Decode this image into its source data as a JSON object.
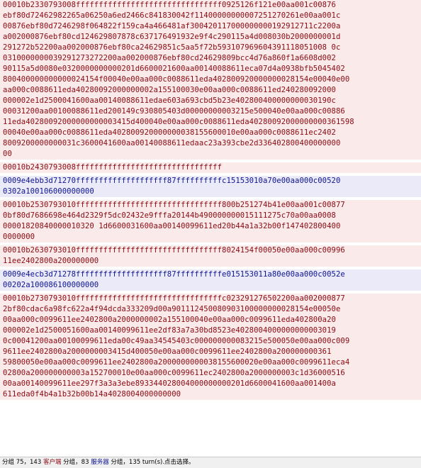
{
  "colors": {
    "client_bg": "#faeaea",
    "client_text": "#8a0a12",
    "server_bg": "#eaeaf8",
    "server_text": "#0e1492"
  },
  "stream": [
    {
      "direction": "client",
      "lines": [
        "00010b2330793008ffffffffffffffffffffffffffffffff0925126f121e00aa001c00876",
        "ebf80d72462982265a06250a6ed2466c841830042f11400000000007251270261e00aa001c",
        "00876ebf80d7246298f064822f159ca4a466481af300420117000000000192912711c2200a",
        "a002000876ebf80cd124629807878c637176491932e9f4c290115a4d008030b2000000001d",
        "291272b52200aa002000876ebf80ca24629851c5aa5f72b593107969604391118051008 0c",
        "0310000000039291273272200aa002000876ebf80cd24629809bcc4d76a860f1a6608d002",
        "90115a5d0080e0320000000000201d6600021600aa00140088611eca07d4a0938bfb5045402",
        "800400000000000024154f00040e00aa000c0088611eda402800920000000028154e00040e00",
        "aa000c0088611eda40280092000000002a155100030e00aa000c0088611ed240280092000",
        "000002e1d2500041600aa00140088611edae603a693cbd5b23e402800400000000030190c",
        "00031200aa00100088611ed200149c930805403d00000000003215e500040e00aa000c00886",
        "11eda40280092000000000003415d400040e00aa000c0088611eda40280092000000000361598",
        "00040e00aa000c0088611eda402800920000000038155600010e00aa000c0088611ec2402",
        "8009200000000031c3600041600aa00140088611edaac23a393cbe2d336402800400000000",
        "00"
      ]
    },
    {
      "direction": "client",
      "lines": [
        "00010b2430793008ffffffffffffffffffffffffffffffff"
      ]
    },
    {
      "direction": "server",
      "lines": [
        "0009e4ebb3d71270ffffffffffffffffffff87ffffffffffc15153010a70e00aa000c00520",
        "0302a100106000000000"
      ]
    },
    {
      "direction": "client",
      "lines": [
        "00010b2530793010ffffffffffffffffffffffffffffffff800b251274b41e00aa001c00877",
        "0bf80d7686698e464d2329f5dc02432e9fffa20144b490000000015111275c70a00aa0008",
        "00001820840000010320 1d6600031600aa00140099611ed20b44a1a32b00f147402800400",
        "0000000"
      ]
    },
    {
      "direction": "client",
      "lines": [
        "00010b2630793010ffffffffffffffffffffffffffffffff8024154f00050e00aa000c00996",
        "11ee2402800a200000000"
      ]
    },
    {
      "direction": "server",
      "lines": [
        "0009e4ecb3d71278ffffffffffffffffffff87ffffffffffe015153011a80e00aa000c0052e",
        "00202a100086100000000"
      ]
    },
    {
      "direction": "client",
      "lines": [
        "00010b2730793010ffffffffffffffffffffffffffffffffc023291276502200aa002000877",
        "2bf80cdac6a98fc622a4f94dcda333209d00a901112450080903100000000028154e00050e",
        "00aa000c0099611ee2402800a2000000002a155100040e00aa000c0099611eda402800a20",
        "000002e1d2500051600aa00140099611ee2df83a7a30bd8523e4028004000000000003019",
        "0c00041200aa00100099611eda00c49aa34545403c000000000083215e500050e00aa000c009",
        "9611ee2402800a2000000003415d400050e00aa000c0099611ee2402800a200000000361",
        "59800050e00aa000c0099611ee2402800a2000000000038155600020e00aa000c0099611eca4",
        "02800a200000000003a152700010e00aa000c0099611ec2402800a2000000003c1d36000516",
        "00aa00140099611ee297f3a3a3ebe893344028004000000000201d6600041600aa001400a",
        "611eda0f4b4a1b32b00b14a4028004000000000"
      ]
    }
  ],
  "status": {
    "prefix": "分组 75，143 ",
    "client_word": "客户端",
    "mid1": " 分组，83 ",
    "server_word": "服务器",
    "suffix": " 分组，135 turn(s).点击选择。"
  }
}
